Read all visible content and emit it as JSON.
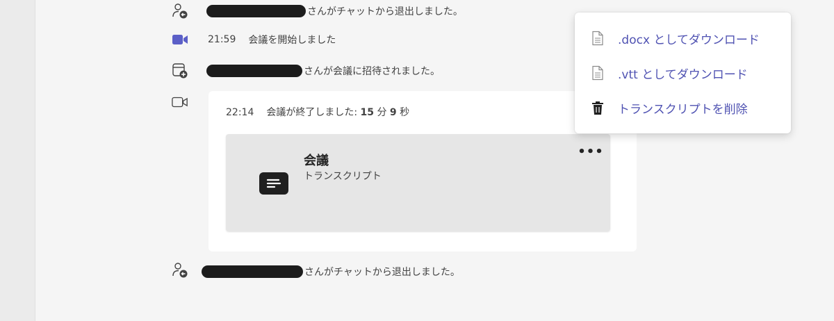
{
  "events": [
    {
      "id": "left-1",
      "suffix": "さんがチャットから退出しました。",
      "icon": "person-leave-icon"
    },
    {
      "id": "meeting-start",
      "time": "21:59",
      "text": "会議を開始しました",
      "icon": "video-camera-filled-icon"
    },
    {
      "id": "invited",
      "suffix": "さんが会議に招待されました。",
      "icon": "calendar-add-icon"
    },
    {
      "id": "left-2",
      "suffix": "さんがチャットから退出しました。",
      "icon": "person-leave-icon"
    }
  ],
  "meeting_card": {
    "time": "22:14",
    "ended_prefix": "会議が終了しました: ",
    "minutes": "15",
    "minutes_unit": " 分 ",
    "seconds": "9",
    "seconds_unit": " 秒",
    "icon": "video-camera-outline-icon"
  },
  "transcript": {
    "title": "会議",
    "subtitle": "トランスクリプト",
    "more_label": "•••",
    "icon": "transcript-document-icon"
  },
  "context_menu": {
    "items": [
      {
        "label": ".docx としてダウンロード",
        "icon": "document-icon"
      },
      {
        "label": ".vtt としてダウンロード",
        "icon": "document-icon"
      },
      {
        "label": "トランスクリプトを削除",
        "icon": "trash-icon"
      }
    ]
  },
  "colors": {
    "accent": "#4f52b2",
    "video_icon": "#5b5fc7",
    "background": "#f5f5f5",
    "card": "#ffffff",
    "transcript_card": "#e6e6e6"
  }
}
